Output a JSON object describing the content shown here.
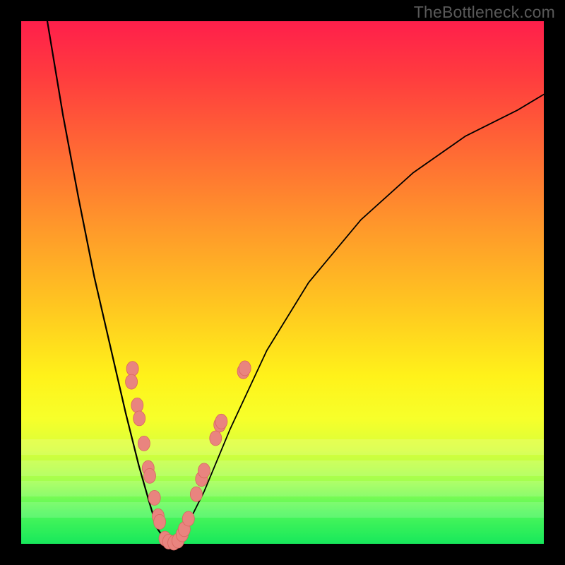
{
  "watermark_text": "TheBottleneck.com",
  "colors": {
    "frame": "#000000",
    "curve": "#000000",
    "marker_fill": "#e9847f",
    "marker_stroke": "#d9655f",
    "gradient_stops": [
      "#ff1f4b",
      "#ff3a3f",
      "#ff6a34",
      "#ff9a2a",
      "#ffc820",
      "#fff21a",
      "#f7ff2a",
      "#d8ff3a",
      "#a3ff4e",
      "#4df75a",
      "#17e85b"
    ]
  },
  "chart_data": {
    "type": "line",
    "title": "",
    "xlabel": "",
    "ylabel": "",
    "xlim": [
      0,
      100
    ],
    "ylim": [
      0,
      100
    ],
    "note": "Axes are unlabeled; values below are normalized 0–100 estimates where y=0 is the curve minimum (green) and y=100 is top (red).",
    "series": [
      {
        "name": "left-branch",
        "x": [
          5,
          8,
          11,
          14,
          17,
          20,
          22.5,
          24.5,
          26,
          27.5,
          28.5
        ],
        "y": [
          100,
          82,
          66,
          51,
          38,
          25,
          15,
          8,
          3,
          0.8,
          0
        ]
      },
      {
        "name": "right-branch",
        "x": [
          28.5,
          30,
          32,
          35,
          40,
          47,
          55,
          65,
          75,
          85,
          95,
          100
        ],
        "y": [
          0,
          1,
          4,
          10,
          22,
          37,
          50,
          62,
          71,
          78,
          83,
          86
        ]
      }
    ],
    "markers": [
      {
        "x": 21.3,
        "y": 33.5
      },
      {
        "x": 21.1,
        "y": 31.0
      },
      {
        "x": 22.2,
        "y": 26.5
      },
      {
        "x": 22.6,
        "y": 24.0
      },
      {
        "x": 23.5,
        "y": 19.2
      },
      {
        "x": 24.3,
        "y": 14.5
      },
      {
        "x": 24.6,
        "y": 13.0
      },
      {
        "x": 25.5,
        "y": 8.8
      },
      {
        "x": 26.2,
        "y": 5.3
      },
      {
        "x": 26.5,
        "y": 4.2
      },
      {
        "x": 27.5,
        "y": 1.0
      },
      {
        "x": 28.2,
        "y": 0.4
      },
      {
        "x": 29.2,
        "y": 0.2
      },
      {
        "x": 30.0,
        "y": 0.6
      },
      {
        "x": 30.8,
        "y": 1.8
      },
      {
        "x": 31.2,
        "y": 2.8
      },
      {
        "x": 32.0,
        "y": 4.8
      },
      {
        "x": 33.5,
        "y": 9.5
      },
      {
        "x": 34.5,
        "y": 12.4
      },
      {
        "x": 35.0,
        "y": 14.0
      },
      {
        "x": 37.2,
        "y": 20.2
      },
      {
        "x": 38.0,
        "y": 22.8
      },
      {
        "x": 38.3,
        "y": 23.4
      },
      {
        "x": 42.5,
        "y": 33.0
      },
      {
        "x": 42.8,
        "y": 33.6
      }
    ]
  }
}
